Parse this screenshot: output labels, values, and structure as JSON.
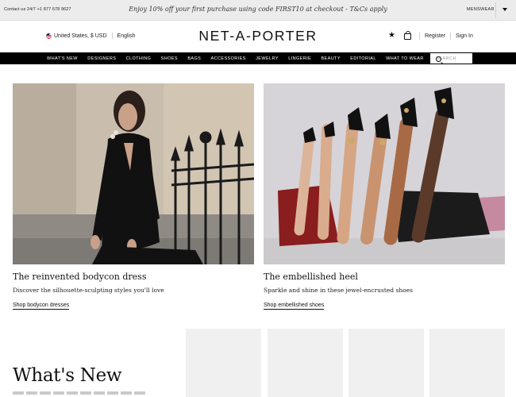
{
  "promo": {
    "contact": "Contact us 24/7 +1 877 678 9627",
    "offer": "Enjoy 10% off your first purchase using code FIRST10 at checkout - T&Cs apply",
    "menswear": "MENSWEAR"
  },
  "header": {
    "country_currency": "United States, $ USD",
    "language": "English",
    "logo": "NET-A-PORTER",
    "register": "Register",
    "sign_in": "Sign In"
  },
  "nav": {
    "items": [
      "WHAT'S NEW",
      "DESIGNERS",
      "CLOTHING",
      "SHOES",
      "BAGS",
      "ACCESSORIES",
      "JEWELRY",
      "LINGERIE",
      "BEAUTY",
      "EDITORIAL",
      "WHAT TO WEAR"
    ],
    "search_placeholder": "SEARCH"
  },
  "cards": [
    {
      "title": "The reinvented bodycon dress",
      "subtitle": "Discover the silhouette-sculpting styles you'll love",
      "link": "Shop bodycon dresses"
    },
    {
      "title": "The embellished heel",
      "subtitle": "Sparkle and shine in these jewel-encrusted shoes",
      "link": "Shop embellished shoes"
    }
  ],
  "whats_new": {
    "title": "What's New"
  },
  "colors": {
    "promo_bg": "#ececec",
    "nav_bg": "#000000",
    "tile_bg": "#f0f0f0"
  },
  "icons": [
    "chevron-down-icon",
    "us-flag-icon",
    "star-icon",
    "shopping-bag-icon",
    "search-icon"
  ]
}
